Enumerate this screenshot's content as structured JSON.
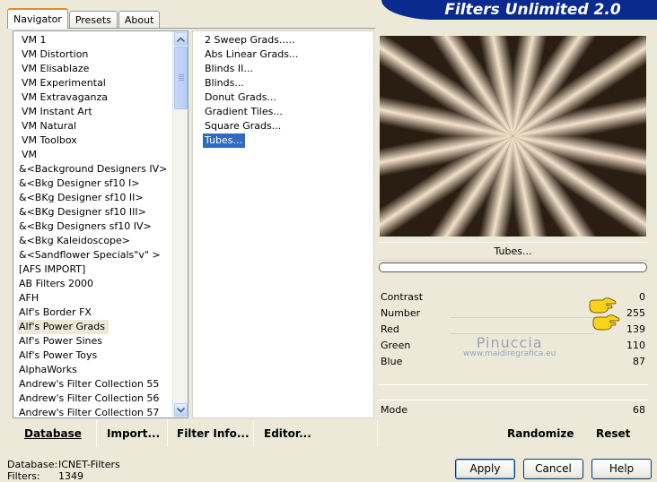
{
  "banner": {
    "title": "Filters Unlimited 2.0"
  },
  "tabs": [
    {
      "label": "Navigator"
    },
    {
      "label": "Presets"
    },
    {
      "label": "About"
    }
  ],
  "categories": [
    "VM 1",
    "VM Distortion",
    "VM Elisablaze",
    "VM Experimental",
    "VM Extravaganza",
    "VM Instant Art",
    "VM Natural",
    "VM Toolbox",
    "VM",
    "&<Background Designers IV>",
    "&<Bkg Designer sf10 I>",
    "&<BKg Designer sf10 II>",
    "&<BKg Designer sf10 III>",
    "&<Bkg Designers sf10 IV>",
    "&<Bkg Kaleidoscope>",
    "&<Sandflower Specials\"v\" >",
    "[AFS IMPORT]",
    "AB Filters 2000",
    "AFH",
    "Alf's Border FX",
    "Alf's Power Grads",
    "Alf's Power Sines",
    "Alf's Power Toys",
    "AlphaWorks",
    "Andrew's Filter Collection 55",
    "Andrew's Filter Collection 56",
    "Andrew's Filter Collection 57"
  ],
  "filters": [
    "2 Sweep Grads.....",
    "Abs Linear Grads...",
    "Blinds II...",
    "Blinds...",
    "Donut Grads...",
    "Gradient Tiles...",
    "Square Grads...",
    "Tubes..."
  ],
  "preview": {
    "filter_name": "Tubes...",
    "progress_percent": 0
  },
  "params": {
    "contrast": {
      "label": "Contrast",
      "value": "0"
    },
    "number": {
      "label": "Number",
      "value": "255"
    },
    "red": {
      "label": "Red",
      "value": "139"
    },
    "green": {
      "label": "Green",
      "value": "110"
    },
    "blue": {
      "label": "Blue",
      "value": "87"
    },
    "mode": {
      "label": "Mode",
      "value": "68"
    }
  },
  "watermark": {
    "name": "Pinuccia",
    "url": "www.maidiregrafica.eu"
  },
  "actions": {
    "database": "Database",
    "import": "Import...",
    "filter_info": "Filter Info...",
    "editor": "Editor...",
    "randomize": "Randomize",
    "reset": "Reset"
  },
  "status": {
    "database_label": "Database:",
    "database_value": "ICNET-Filters",
    "filters_label": "Filters:",
    "filters_value": "1349"
  },
  "buttons": {
    "apply": "Apply",
    "cancel": "Cancel",
    "help": "Help"
  },
  "colors": {
    "preview_dark": "#2a1d12",
    "preview_light": "#f2e2cb",
    "selection": "#316ac5",
    "banner": "#0b2a8f"
  }
}
